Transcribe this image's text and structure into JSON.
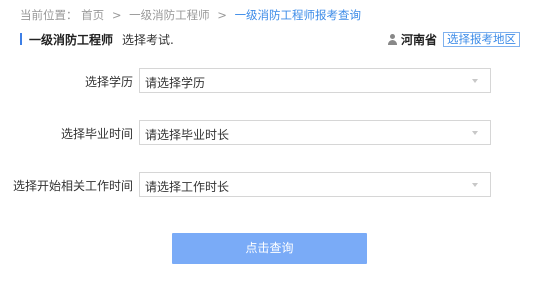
{
  "breadcrumb": {
    "prefix": "当前位置：",
    "items": [
      "首页",
      "一级消防工程师",
      "一级消防工程师报考查询"
    ],
    "separator": ">"
  },
  "header": {
    "title": "一级消防工程师",
    "subtitle": "选择考试."
  },
  "region": {
    "icon": "user-icon",
    "province": "河南省",
    "change_label": "选择报考地区"
  },
  "form": {
    "education": {
      "label": "选择学历",
      "value": "请选择学历"
    },
    "graduation": {
      "label": "选择毕业时间",
      "value": "请选择毕业时长"
    },
    "work_start": {
      "label": "选择开始相关工作时间",
      "value": "请选择工作时长"
    }
  },
  "submit_label": "点击查询",
  "colors": {
    "accent": "#3d8ce8",
    "button": "#7aabf7",
    "border": "#d6d6d6"
  }
}
